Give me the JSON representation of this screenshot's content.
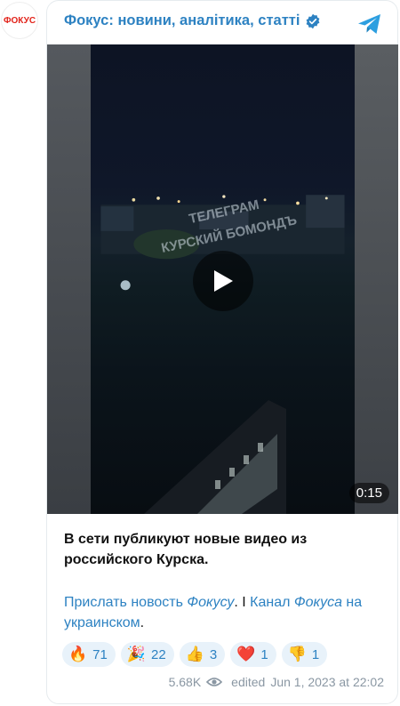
{
  "avatar": {
    "logo_text": "ФОКУС"
  },
  "channel": {
    "title": "Фокус: новини, аналітика, статті"
  },
  "video": {
    "watermark_line1": "ТЕЛЕГРАМ",
    "watermark_line2": "КУРСКИЙ БОМОНДЪ",
    "duration": "0:15"
  },
  "post": {
    "text": "В сети публикуют новые видео из российского Курска.",
    "link1": "Прислать новость ",
    "link1_italic": "Фокусу",
    "sep": ". I ",
    "link2": "Канал ",
    "link2_italic": "Фокуса",
    "link2_rest": " на украинском",
    "end": "."
  },
  "reactions": [
    {
      "emoji": "🔥",
      "icon": "fire-icon",
      "count": "71"
    },
    {
      "emoji": "🎉",
      "icon": "party-icon",
      "count": "22"
    },
    {
      "emoji": "👍",
      "icon": "thumbs-up-icon",
      "count": "3"
    },
    {
      "emoji": "❤️",
      "icon": "heart-icon",
      "count": "1"
    },
    {
      "emoji": "👎",
      "icon": "thumbs-down-icon",
      "count": "1"
    }
  ],
  "footer": {
    "views": "5.68K",
    "edited": "edited",
    "date": "Jun 1, 2023 at 22:02"
  },
  "colors": {
    "accent": "#2d82c2",
    "reaction_bg": "#e8f2fa",
    "muted": "#8a97a3"
  }
}
